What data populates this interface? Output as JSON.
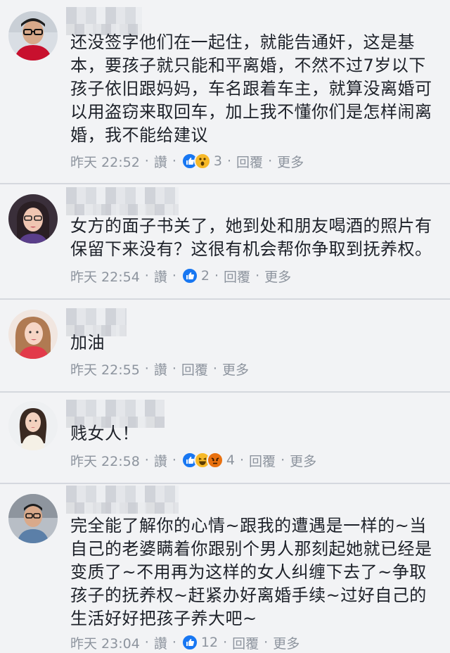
{
  "comments": [
    {
      "text": "还没签字他们在一起住，就能告通奸，这是基本，要孩子就只能和平离婚，不然不过7岁以下孩子依旧跟妈妈，车名跟着车主，就算没离婚可以用盗窃来取回车，加上我不懂你们是怎样闹离婚，我不能给建议",
      "time": "昨天 22:52",
      "like_label": "讚",
      "reactions": [
        "like-icon",
        "wow-icon"
      ],
      "reaction_count": "3",
      "reply_label": "回覆",
      "more_label": "更多"
    },
    {
      "text": "女方的面子书关了，她到处和朋友喝酒的照片有保留下来没有？这很有机会帮你争取到抚养权。",
      "time": "昨天 22:54",
      "like_label": "讚",
      "reactions": [
        "like-icon"
      ],
      "reaction_count": "2",
      "reply_label": "回覆",
      "more_label": "更多"
    },
    {
      "text": "加油",
      "time": "昨天 22:55",
      "like_label": "讚",
      "reactions": [],
      "reaction_count": "",
      "reply_label": "回覆",
      "more_label": "更多"
    },
    {
      "text": "贱女人！",
      "time": "昨天 22:58",
      "like_label": "讚",
      "reactions": [
        "like-icon",
        "haha-icon",
        "angry-icon"
      ],
      "reaction_count": "4",
      "reply_label": "回覆",
      "more_label": "更多"
    },
    {
      "text": "完全能了解你的心情~跟我的遭遇是一样的~当自己的老婆瞒着你跟别个男人那刻起她就已经是变质了~不用再为这样的女人纠缠下去了~争取孩子的抚养权~赶紧办好离婚手续~过好自己的生活好好把孩子养大吧~",
      "time": "昨天 23:04",
      "like_label": "讚",
      "reactions": [
        "like-icon"
      ],
      "reaction_count": "12",
      "reply_label": "回覆",
      "more_label": "更多"
    }
  ],
  "colors": {
    "background": "#f2f3f5",
    "text": "#1d2129",
    "meta": "#8d949e",
    "like_blue": "#1877f2",
    "reaction_yellow": "#f7b928",
    "angry_orange": "#e9710f"
  }
}
